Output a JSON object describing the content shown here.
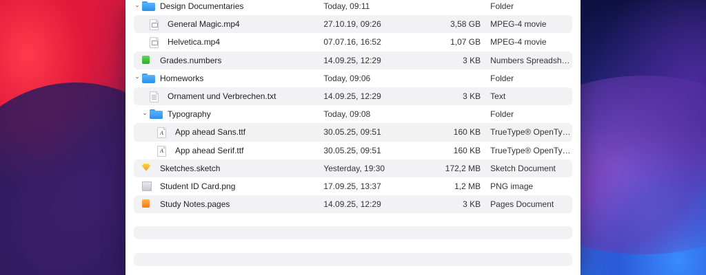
{
  "files": [
    {
      "name": "Design Documentaries",
      "date": "Today, 09:11",
      "size": "",
      "kind": "Folder",
      "level": 0,
      "icon": "folder-icon",
      "disclosure": true
    },
    {
      "name": "General Magic.mp4",
      "date": "27.10.19, 09:26",
      "size": "3,58 GB",
      "kind": "MPEG-4 movie",
      "level": 1,
      "icon": "movie-file-icon",
      "disclosure": false
    },
    {
      "name": "Helvetica.mp4",
      "date": "07.07.16, 16:52",
      "size": "1,07 GB",
      "kind": "MPEG-4 movie",
      "level": 1,
      "icon": "movie-file-icon",
      "disclosure": false
    },
    {
      "name": "Grades.numbers",
      "date": "14.09.25, 12:29",
      "size": "3 KB",
      "kind": "Numbers Spreadsheet",
      "level": 0,
      "icon": "numbers-file-icon",
      "disclosure": false
    },
    {
      "name": "Homeworks",
      "date": "Today, 09:06",
      "size": "",
      "kind": "Folder",
      "level": 0,
      "icon": "folder-icon",
      "disclosure": true
    },
    {
      "name": "Ornament und Verbrechen.txt",
      "date": "14.09.25, 12:29",
      "size": "3 KB",
      "kind": "Text",
      "level": 1,
      "icon": "text-file-icon",
      "disclosure": false
    },
    {
      "name": "Typography",
      "date": "Today, 09:08",
      "size": "",
      "kind": "Folder",
      "level": 1,
      "icon": "folder-icon",
      "disclosure": true
    },
    {
      "name": "App ahead Sans.ttf",
      "date": "30.05.25, 09:51",
      "size": "160 KB",
      "kind": "TrueType® OpenType...",
      "level": 2,
      "icon": "font-file-icon",
      "disclosure": false
    },
    {
      "name": "App ahead Serif.ttf",
      "date": "30.05.25, 09:51",
      "size": "160 KB",
      "kind": "TrueType® OpenType...",
      "level": 2,
      "icon": "font-file-icon",
      "disclosure": false
    },
    {
      "name": "Sketches.sketch",
      "date": "Yesterday, 19:30",
      "size": "172,2 MB",
      "kind": "Sketch Document",
      "level": 0,
      "icon": "sketch-file-icon",
      "disclosure": false
    },
    {
      "name": "Student ID Card.png",
      "date": "17.09.25, 13:37",
      "size": "1,2 MB",
      "kind": "PNG image",
      "level": 0,
      "icon": "image-file-icon",
      "disclosure": false
    },
    {
      "name": "Study Notes.pages",
      "date": "14.09.25, 12:29",
      "size": "3 KB",
      "kind": "Pages Document",
      "level": 0,
      "icon": "pages-file-icon",
      "disclosure": false
    }
  ],
  "colors": {
    "folder": "#3a9bf0",
    "row_alt": "#f2f2f4",
    "wallpaper_red": "#e8183a",
    "wallpaper_blue": "#2a6ae0"
  }
}
